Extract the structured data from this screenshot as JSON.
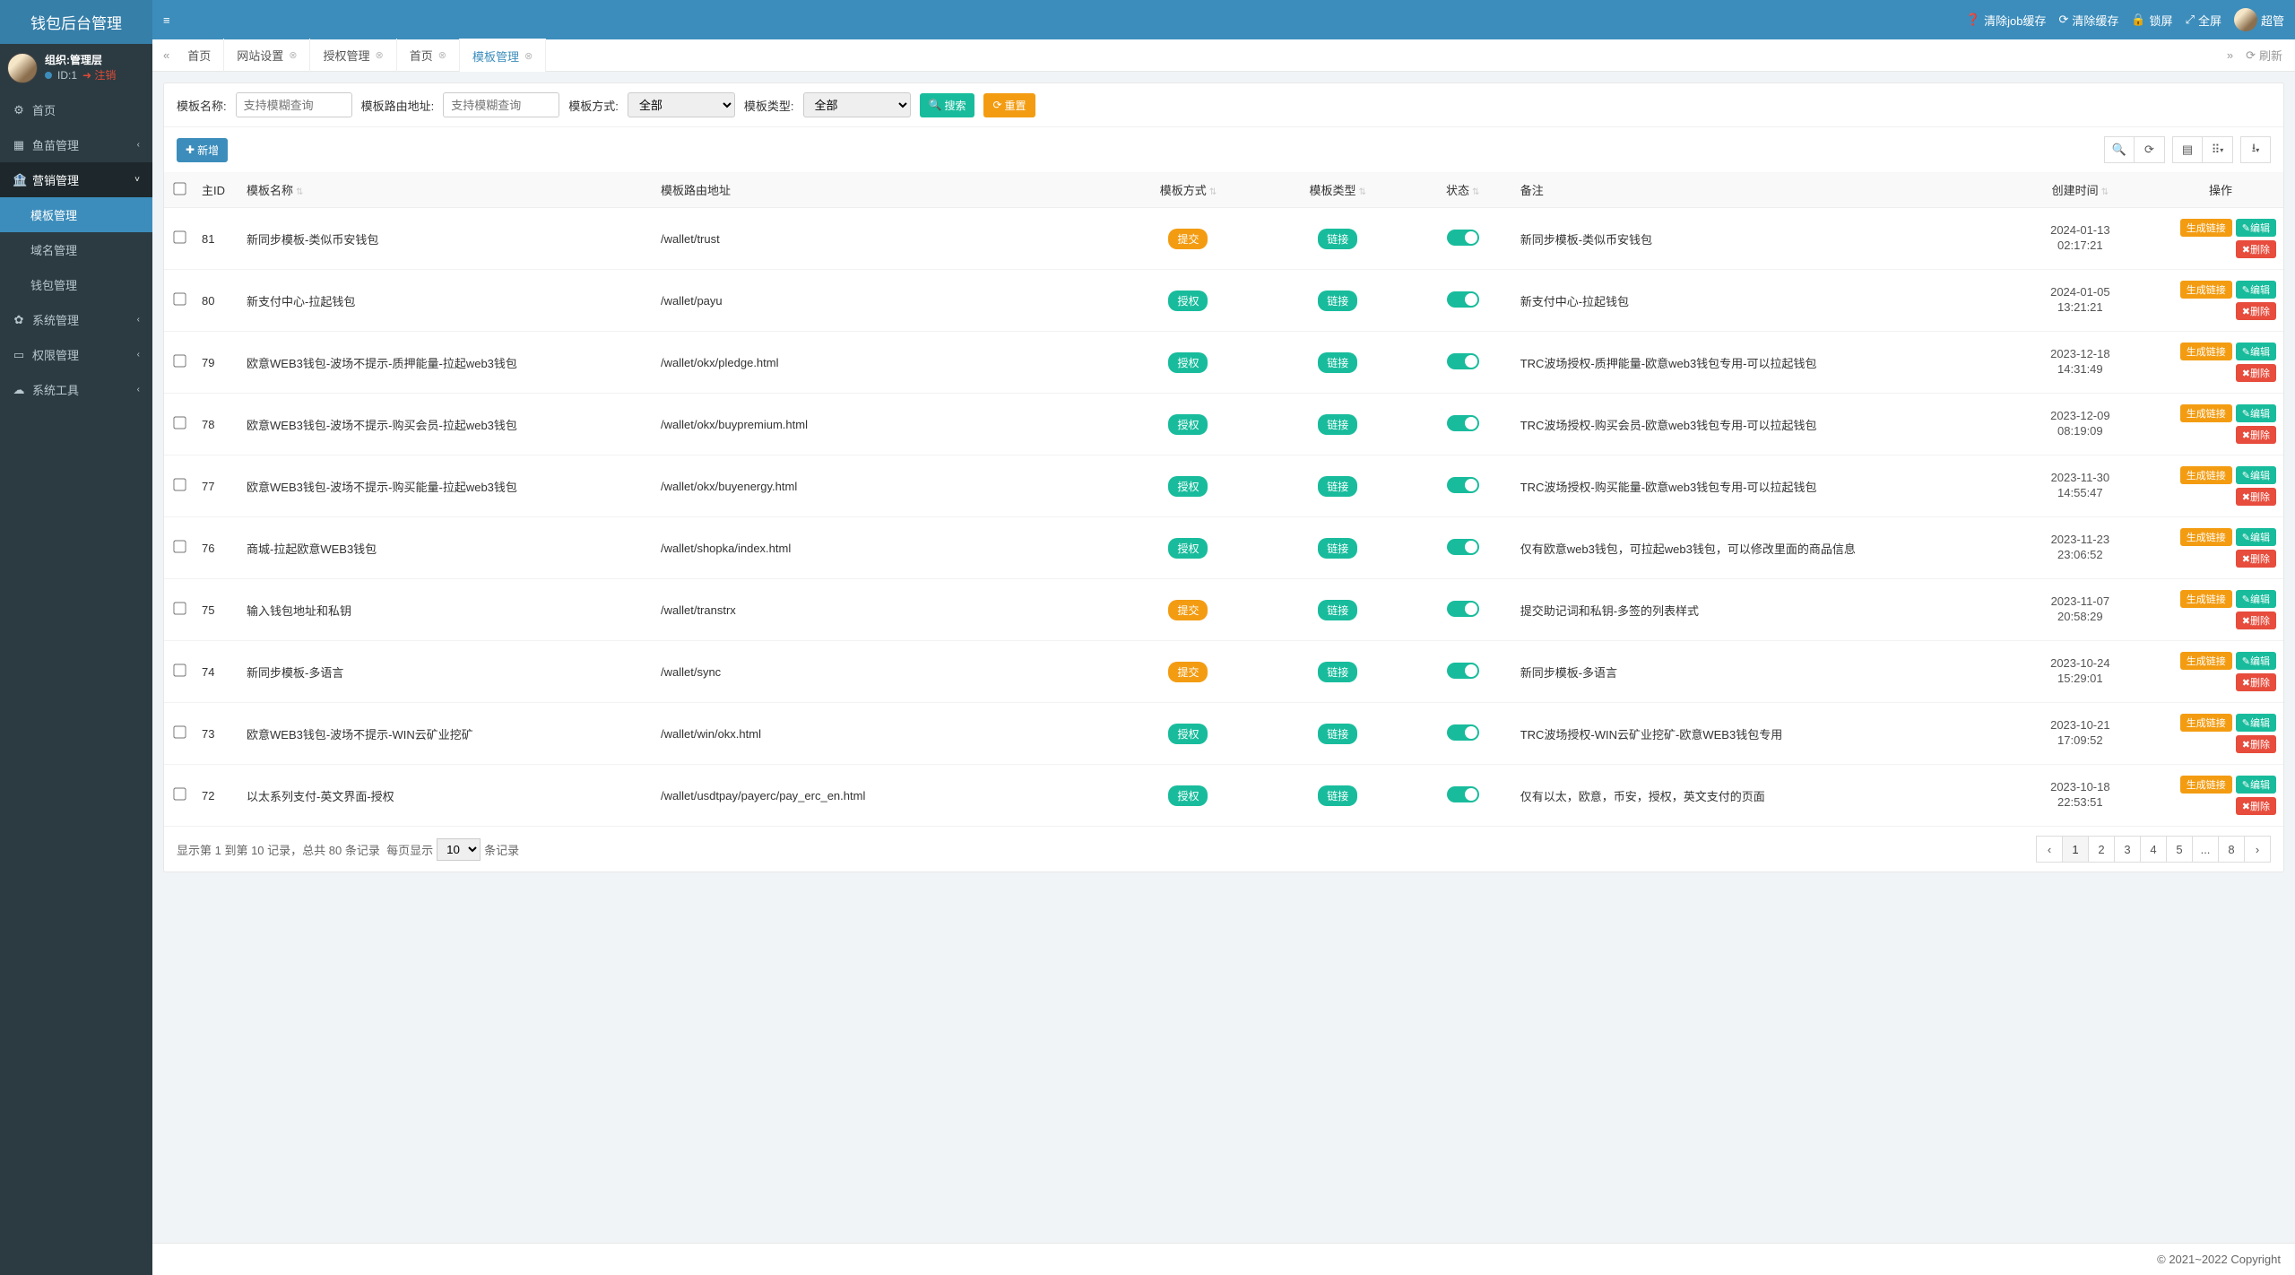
{
  "logo": "钱包后台管理",
  "user": {
    "org": "组织:管理层",
    "id_label": "ID:1",
    "logout": "注销"
  },
  "sidebar": {
    "items": [
      {
        "label": "首页",
        "icon": "⚙"
      },
      {
        "label": "鱼苗管理",
        "icon": "▦"
      },
      {
        "label": "营销管理",
        "icon": "🏦",
        "expanded": true
      },
      {
        "label": "系统管理",
        "icon": "✿"
      },
      {
        "label": "权限管理",
        "icon": "▭"
      },
      {
        "label": "系统工具",
        "icon": "☁"
      }
    ],
    "subitems": [
      {
        "label": "模板管理",
        "active": true
      },
      {
        "label": "域名管理"
      },
      {
        "label": "钱包管理"
      }
    ]
  },
  "topbar": {
    "clear_job": "清除job缓存",
    "clear_cache": "清除缓存",
    "lock": "锁屏",
    "fullscreen": "全屏",
    "username": "超管"
  },
  "tabs": [
    {
      "label": "首页",
      "closable": false
    },
    {
      "label": "网站设置",
      "closable": true
    },
    {
      "label": "授权管理",
      "closable": true
    },
    {
      "label": "首页",
      "closable": true
    },
    {
      "label": "模板管理",
      "closable": true,
      "active": true
    }
  ],
  "tabbar_refresh": "刷新",
  "filters": {
    "name_label": "模板名称:",
    "name_placeholder": "支持模糊查询",
    "route_label": "模板路由地址:",
    "route_placeholder": "支持模糊查询",
    "mode_label": "模板方式:",
    "mode_value": "全部",
    "type_label": "模板类型:",
    "type_value": "全部",
    "search_btn": "搜索",
    "reset_btn": "重置"
  },
  "add_btn": "新增",
  "columns": {
    "id": "主ID",
    "name": "模板名称",
    "route": "模板路由地址",
    "mode": "模板方式",
    "type": "模板类型",
    "status": "状态",
    "remark": "备注",
    "created": "创建时间",
    "ops": "操作"
  },
  "mode_labels": {
    "submit": "提交",
    "auth": "授权"
  },
  "type_labels": {
    "link": "链接"
  },
  "op_labels": {
    "gen": "生成链接",
    "edit": "编辑",
    "del": "删除"
  },
  "rows": [
    {
      "id": "81",
      "name": "新同步模板-类似币安钱包",
      "route": "/wallet/trust",
      "mode": "submit",
      "type": "link",
      "remark": "新同步模板-类似币安钱包",
      "date1": "2024-01-13",
      "date2": "02:17:21"
    },
    {
      "id": "80",
      "name": "新支付中心-拉起钱包",
      "route": "/wallet/payu",
      "mode": "auth",
      "type": "link",
      "remark": "新支付中心-拉起钱包",
      "date1": "2024-01-05",
      "date2": "13:21:21"
    },
    {
      "id": "79",
      "name": "欧意WEB3钱包-波场不提示-质押能量-拉起web3钱包",
      "route": "/wallet/okx/pledge.html",
      "mode": "auth",
      "type": "link",
      "remark": "TRC波场授权-质押能量-欧意web3钱包专用-可以拉起钱包",
      "date1": "2023-12-18",
      "date2": "14:31:49"
    },
    {
      "id": "78",
      "name": "欧意WEB3钱包-波场不提示-购买会员-拉起web3钱包",
      "route": "/wallet/okx/buypremium.html",
      "mode": "auth",
      "type": "link",
      "remark": "TRC波场授权-购买会员-欧意web3钱包专用-可以拉起钱包",
      "date1": "2023-12-09",
      "date2": "08:19:09"
    },
    {
      "id": "77",
      "name": "欧意WEB3钱包-波场不提示-购买能量-拉起web3钱包",
      "route": "/wallet/okx/buyenergy.html",
      "mode": "auth",
      "type": "link",
      "remark": "TRC波场授权-购买能量-欧意web3钱包专用-可以拉起钱包",
      "date1": "2023-11-30",
      "date2": "14:55:47"
    },
    {
      "id": "76",
      "name": "商城-拉起欧意WEB3钱包",
      "route": "/wallet/shopka/index.html",
      "mode": "auth",
      "type": "link",
      "remark": "仅有欧意web3钱包，可拉起web3钱包，可以修改里面的商品信息",
      "date1": "2023-11-23",
      "date2": "23:06:52"
    },
    {
      "id": "75",
      "name": "输入钱包地址和私钥",
      "route": "/wallet/transtrx",
      "mode": "submit",
      "type": "link",
      "remark": "提交助记词和私钥-多签的列表样式",
      "date1": "2023-11-07",
      "date2": "20:58:29"
    },
    {
      "id": "74",
      "name": "新同步模板-多语言",
      "route": "/wallet/sync",
      "mode": "submit",
      "type": "link",
      "remark": "新同步模板-多语言",
      "date1": "2023-10-24",
      "date2": "15:29:01"
    },
    {
      "id": "73",
      "name": "欧意WEB3钱包-波场不提示-WIN云矿业挖矿",
      "route": "/wallet/win/okx.html",
      "mode": "auth",
      "type": "link",
      "remark": "TRC波场授权-WIN云矿业挖矿-欧意WEB3钱包专用",
      "date1": "2023-10-21",
      "date2": "17:09:52"
    },
    {
      "id": "72",
      "name": "以太系列支付-英文界面-授权",
      "route": "/wallet/usdtpay/payerc/pay_erc_en.html",
      "mode": "auth",
      "type": "link",
      "remark": "仅有以太，欧意，币安，授权，英文支付的页面",
      "date1": "2023-10-18",
      "date2": "22:53:51"
    }
  ],
  "paging": {
    "summary_pre": "显示第 1 到第 10 记录，总共 80 条记录",
    "per_label_pre": "每页显示",
    "per_value": "10",
    "per_label_post": "条记录",
    "pages": [
      "‹",
      "1",
      "2",
      "3",
      "4",
      "5",
      "...",
      "8",
      "›"
    ],
    "active_page": "1"
  },
  "footer": "© 2021~2022 Copyright"
}
